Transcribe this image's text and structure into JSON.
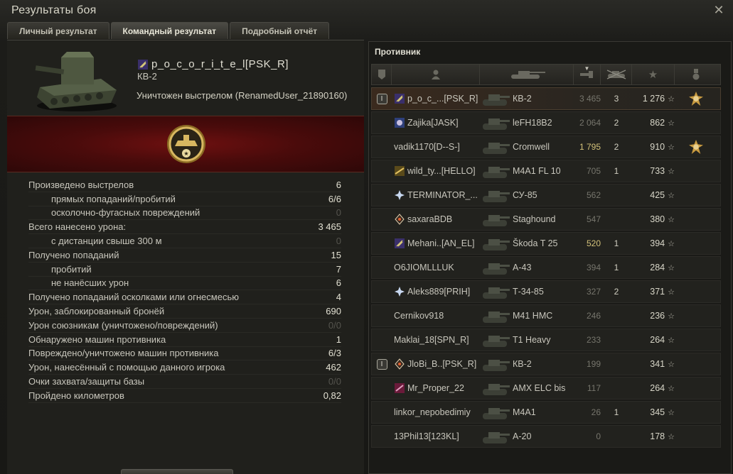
{
  "window": {
    "title": "Результаты боя",
    "close_label": "✕"
  },
  "tabs": [
    {
      "label": "Личный результат",
      "active": false
    },
    {
      "label": "Командный результат",
      "active": true
    },
    {
      "label": "Подробный отчёт",
      "active": false
    }
  ],
  "personal": {
    "player_name": "p_o_c_o_r_i_t_e_l[PSK_R]",
    "tank": "КВ-2",
    "destroyed_by": "Уничтожен выстрелом (RenamedUser_21890160)",
    "medal_icon": "tank-mastery-medal-icon",
    "stats": [
      {
        "label": "Произведено выстрелов",
        "value": "6",
        "sub": false,
        "zero": false
      },
      {
        "label": "прямых попаданий/пробитий",
        "value": "6/6",
        "sub": true,
        "zero": false
      },
      {
        "label": "осколочно-фугасных повреждений",
        "value": "0",
        "sub": true,
        "zero": true
      },
      {
        "label": "Всего нанесено урона:",
        "value": "3 465",
        "sub": false,
        "zero": false
      },
      {
        "label": "с дистанции свыше 300 м",
        "value": "0",
        "sub": true,
        "zero": true
      },
      {
        "label": "Получено попаданий",
        "value": "15",
        "sub": false,
        "zero": false
      },
      {
        "label": "пробитий",
        "value": "7",
        "sub": true,
        "zero": false
      },
      {
        "label": "не нанёсших урон",
        "value": "6",
        "sub": true,
        "zero": false
      },
      {
        "label": "Получено попаданий осколками или огнесмесью",
        "value": "4",
        "sub": false,
        "zero": false
      },
      {
        "label": "Урон, заблокированный бронёй",
        "value": "690",
        "sub": false,
        "zero": false
      },
      {
        "label": "Урон союзникам (уничтожено/повреждений)",
        "value": "0/0",
        "sub": false,
        "zero": true
      },
      {
        "label": "Обнаружено машин противника",
        "value": "1",
        "sub": false,
        "zero": false
      },
      {
        "label": "Повреждено/уничтожено машин противника",
        "value": "6/3",
        "sub": false,
        "zero": false
      },
      {
        "label": "Урон, нанесённый с помощью данного игрока",
        "value": "462",
        "sub": false,
        "zero": false
      },
      {
        "label": "Очки захвата/защиты базы",
        "value": "0/0",
        "sub": false,
        "zero": true
      },
      {
        "label": "Пройдено километров",
        "value": "0,82",
        "sub": false,
        "zero": false
      }
    ]
  },
  "team": {
    "title": "Противник",
    "columns": [
      "platoon-icon",
      "player-icon",
      "tank-icon",
      "damage-icon",
      "kills-icon",
      "experience-star-icon",
      "medal-icon"
    ],
    "rows": [
      {
        "platoon": "I",
        "clan_icon": "clan-emblem-purple",
        "name": "p_o_c_...[PSK_R]",
        "tank": "КВ-2",
        "damage": "3 465",
        "kills": "3",
        "xp": "1 276",
        "medal": true,
        "self": true,
        "dmg_hl": false
      },
      {
        "platoon": "",
        "clan_icon": "clan-emblem-blue",
        "name": "Zajika[JASK]",
        "tank": "leFH18B2",
        "damage": "2 064",
        "kills": "2",
        "xp": "862",
        "medal": false,
        "self": false,
        "dmg_hl": false
      },
      {
        "platoon": "",
        "clan_icon": "",
        "name": "vadik1170[D--S-]",
        "tank": "Cromwell",
        "damage": "1 795",
        "kills": "2",
        "xp": "910",
        "medal": true,
        "self": false,
        "dmg_hl": true
      },
      {
        "platoon": "",
        "clan_icon": "clan-emblem-gold",
        "name": "wild_ty...[HELLO]",
        "tank": "M4A1 FL 10",
        "damage": "705",
        "kills": "1",
        "xp": "733",
        "medal": false,
        "self": false,
        "dmg_hl": false
      },
      {
        "platoon": "",
        "clan_icon": "clan-emblem-star",
        "name": "TERMINATOR_...",
        "tank": "СУ-85",
        "damage": "562",
        "kills": "",
        "xp": "425",
        "medal": false,
        "self": false,
        "dmg_hl": false
      },
      {
        "platoon": "",
        "clan_icon": "clan-emblem-diamond",
        "name": "saxaraBDB",
        "tank": "Staghound",
        "damage": "547",
        "kills": "",
        "xp": "380",
        "medal": false,
        "self": false,
        "dmg_hl": false
      },
      {
        "platoon": "",
        "clan_icon": "clan-emblem-purple",
        "name": "Mehani..[AN_EL]",
        "tank": "Škoda T 25",
        "damage": "520",
        "kills": "1",
        "xp": "394",
        "medal": false,
        "self": false,
        "dmg_hl": true
      },
      {
        "platoon": "",
        "clan_icon": "",
        "name": "O6JIOMLLLUK",
        "tank": "А-43",
        "damage": "394",
        "kills": "1",
        "xp": "284",
        "medal": false,
        "self": false,
        "dmg_hl": false
      },
      {
        "platoon": "",
        "clan_icon": "clan-emblem-star",
        "name": "Aleks889[PRIH]",
        "tank": "Т-34-85",
        "damage": "327",
        "kills": "2",
        "xp": "371",
        "medal": false,
        "self": false,
        "dmg_hl": false
      },
      {
        "platoon": "",
        "clan_icon": "",
        "name": "Cernikov918",
        "tank": "M41 HMC",
        "damage": "246",
        "kills": "",
        "xp": "236",
        "medal": false,
        "self": false,
        "dmg_hl": false
      },
      {
        "platoon": "",
        "clan_icon": "",
        "name": "Maklai_18[SPN_R]",
        "tank": "T1 Heavy",
        "damage": "233",
        "kills": "",
        "xp": "264",
        "medal": false,
        "self": false,
        "dmg_hl": false
      },
      {
        "platoon": "I",
        "clan_icon": "clan-emblem-diamond",
        "name": "JloBi_B..[PSK_R]",
        "tank": "КВ-2",
        "damage": "199",
        "kills": "",
        "xp": "341",
        "medal": false,
        "self": false,
        "dmg_hl": false
      },
      {
        "platoon": "",
        "clan_icon": "clan-emblem-red",
        "name": "Mr_Proper_22",
        "tank": "AMX ELC bis",
        "damage": "117",
        "kills": "",
        "xp": "264",
        "medal": false,
        "self": false,
        "dmg_hl": false
      },
      {
        "platoon": "",
        "clan_icon": "",
        "name": "linkor_nepobedimiy",
        "tank": "M4A1",
        "damage": "26",
        "kills": "1",
        "xp": "345",
        "medal": false,
        "self": false,
        "dmg_hl": false
      },
      {
        "platoon": "",
        "clan_icon": "",
        "name": "13Phil13[123KL]",
        "tank": "А-20",
        "damage": "0",
        "kills": "",
        "xp": "178",
        "medal": false,
        "self": false,
        "dmg_hl": false
      }
    ]
  }
}
